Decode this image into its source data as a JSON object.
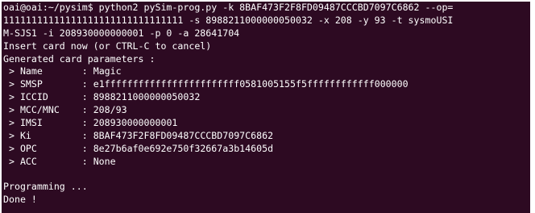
{
  "terminal": {
    "command_lines": [
      "oai@oai:~/pysim$ python2 pySim-prog.py -k 8BAF473F2F8FD09487CCCBD7097C6862 --op=",
      "11111111111111111111111111111111 -s 8988211000000050032 -x 208 -y 93 -t sysmoUSI",
      "M-SJS1 -i 208930000000001 -p 0 -a 28641704"
    ],
    "insert_prompt": "Insert card now (or CTRL-C to cancel)",
    "generated_header": "Generated card parameters :",
    "params": [
      {
        "key": " > Name",
        "value": ": Magic"
      },
      {
        "key": " > SMSP",
        "value": ": e1ffffffffffffffffffffffff0581005155f5ffffffffffff000000"
      },
      {
        "key": " > ICCID",
        "value": ": 8988211000000050032"
      },
      {
        "key": " > MCC/MNC",
        "value": ": 208/93"
      },
      {
        "key": " > IMSI",
        "value": ": 208930000000001"
      },
      {
        "key": " > Ki",
        "value": ": 8BAF473F2F8FD09487CCCBD7097C6862"
      },
      {
        "key": " > OPC",
        "value": ": 8e27b6af0e692e750f32667a3b14605d"
      },
      {
        "key": " > ACC",
        "value": ": None"
      }
    ],
    "programming": "Programming ...",
    "done": "Done !"
  }
}
